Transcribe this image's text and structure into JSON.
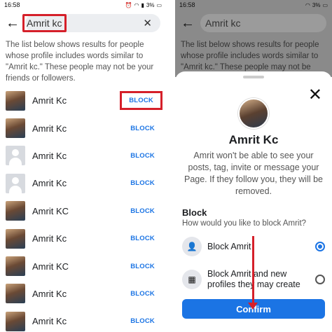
{
  "status": {
    "time": "16:58",
    "battery": "3%"
  },
  "search": {
    "value": "Amrit kc"
  },
  "info_text": "The list below shows results for people whose profile includes words similar to \"Amrit kc.\" These people may not be your friends or followers.",
  "results": [
    {
      "name": "Amrit Kc",
      "action": "BLOCK",
      "avatar": "photo"
    },
    {
      "name": "Amrit Kc",
      "action": "BLOCK",
      "avatar": "photo"
    },
    {
      "name": "Amrit Kc",
      "action": "BLOCK",
      "avatar": "default"
    },
    {
      "name": "Amrit Kc",
      "action": "BLOCK",
      "avatar": "default"
    },
    {
      "name": "Amrit KC",
      "action": "BLOCK",
      "avatar": "photo"
    },
    {
      "name": "Amrit Kc",
      "action": "BLOCK",
      "avatar": "photo"
    },
    {
      "name": "Amrit KC",
      "action": "BLOCK",
      "avatar": "photo"
    },
    {
      "name": "Amrit Kc",
      "action": "BLOCK",
      "avatar": "photo"
    },
    {
      "name": "Amrit Kc",
      "action": "BLOCK",
      "avatar": "photo"
    }
  ],
  "sheet": {
    "name": "Amrit Kc",
    "description": "Amrit won't be able to see your posts, tag, invite or message your Page. If they follow you, they will be removed.",
    "section_title": "Block",
    "section_subtitle": "How would you like to block Amrit?",
    "options": [
      {
        "label": "Block Amrit",
        "selected": true,
        "icon": "person-block-icon"
      },
      {
        "label": "Block Amrit and new profiles they may create",
        "selected": false,
        "icon": "profile-block-icon"
      }
    ],
    "confirm_label": "Confirm"
  },
  "colors": {
    "accent": "#1b74e4",
    "highlight": "#d5202a"
  }
}
